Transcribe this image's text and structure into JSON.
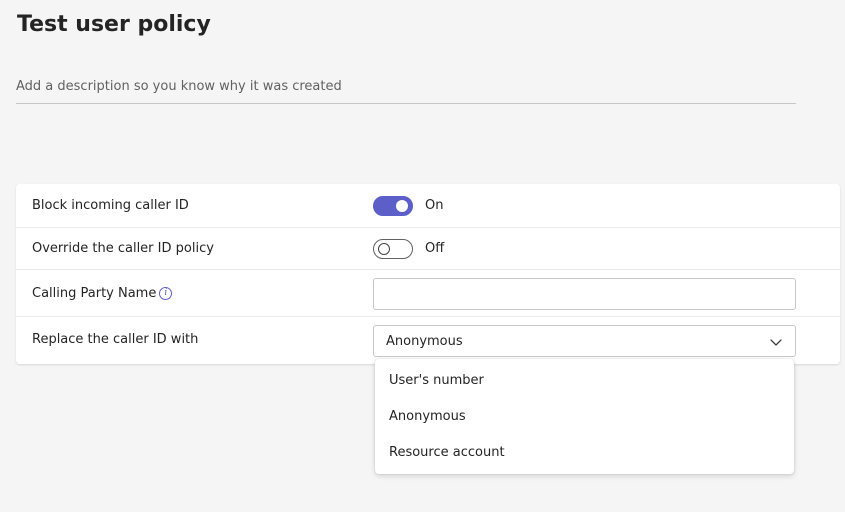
{
  "header": {
    "title": "Test user policy",
    "description_placeholder": "Add a description so you know why it was created",
    "description_value": ""
  },
  "settings": {
    "block_incoming": {
      "label": "Block incoming caller ID",
      "state": "On",
      "enabled": true
    },
    "override_policy": {
      "label": "Override the caller ID policy",
      "state": "Off",
      "enabled": false
    },
    "calling_party_name": {
      "label": "Calling Party Name",
      "value": "",
      "info_icon": "info-icon"
    },
    "replace_caller_id": {
      "label": "Replace the caller ID with",
      "selected": "Anonymous",
      "icon": "chevron-down-icon"
    }
  },
  "dropdown": {
    "options": [
      "User's number",
      "Anonymous",
      "Resource account"
    ]
  },
  "colors": {
    "accent": "#5b5fc7",
    "background": "#f5f5f5",
    "card": "#ffffff",
    "text": "#242424"
  }
}
